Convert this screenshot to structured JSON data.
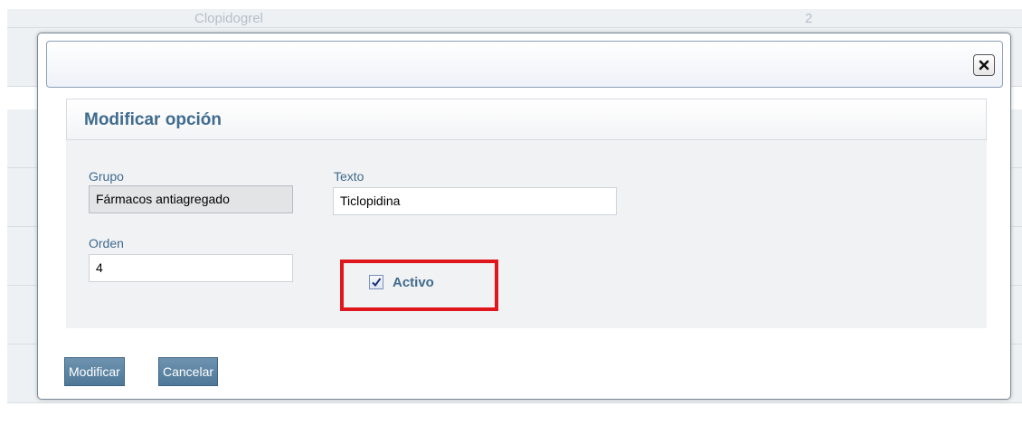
{
  "background": {
    "top_row": {
      "name": "Clopidogrel",
      "value": "2"
    }
  },
  "dialog": {
    "close_icon": "close-icon",
    "section_title": "Modificar opción",
    "fields": {
      "grupo": {
        "label": "Grupo",
        "value": "Fármacos antiagregado"
      },
      "texto": {
        "label": "Texto",
        "value": "Ticlopidina"
      },
      "orden": {
        "label": "Orden",
        "value": "4"
      },
      "activo": {
        "label": "Activo",
        "checked": true
      }
    },
    "buttons": {
      "modify": "Modificar",
      "cancel": "Cancelar"
    }
  },
  "colors": {
    "accent": "#3f6b8e",
    "button": "#5a84a4",
    "highlight": "#e0161d"
  }
}
